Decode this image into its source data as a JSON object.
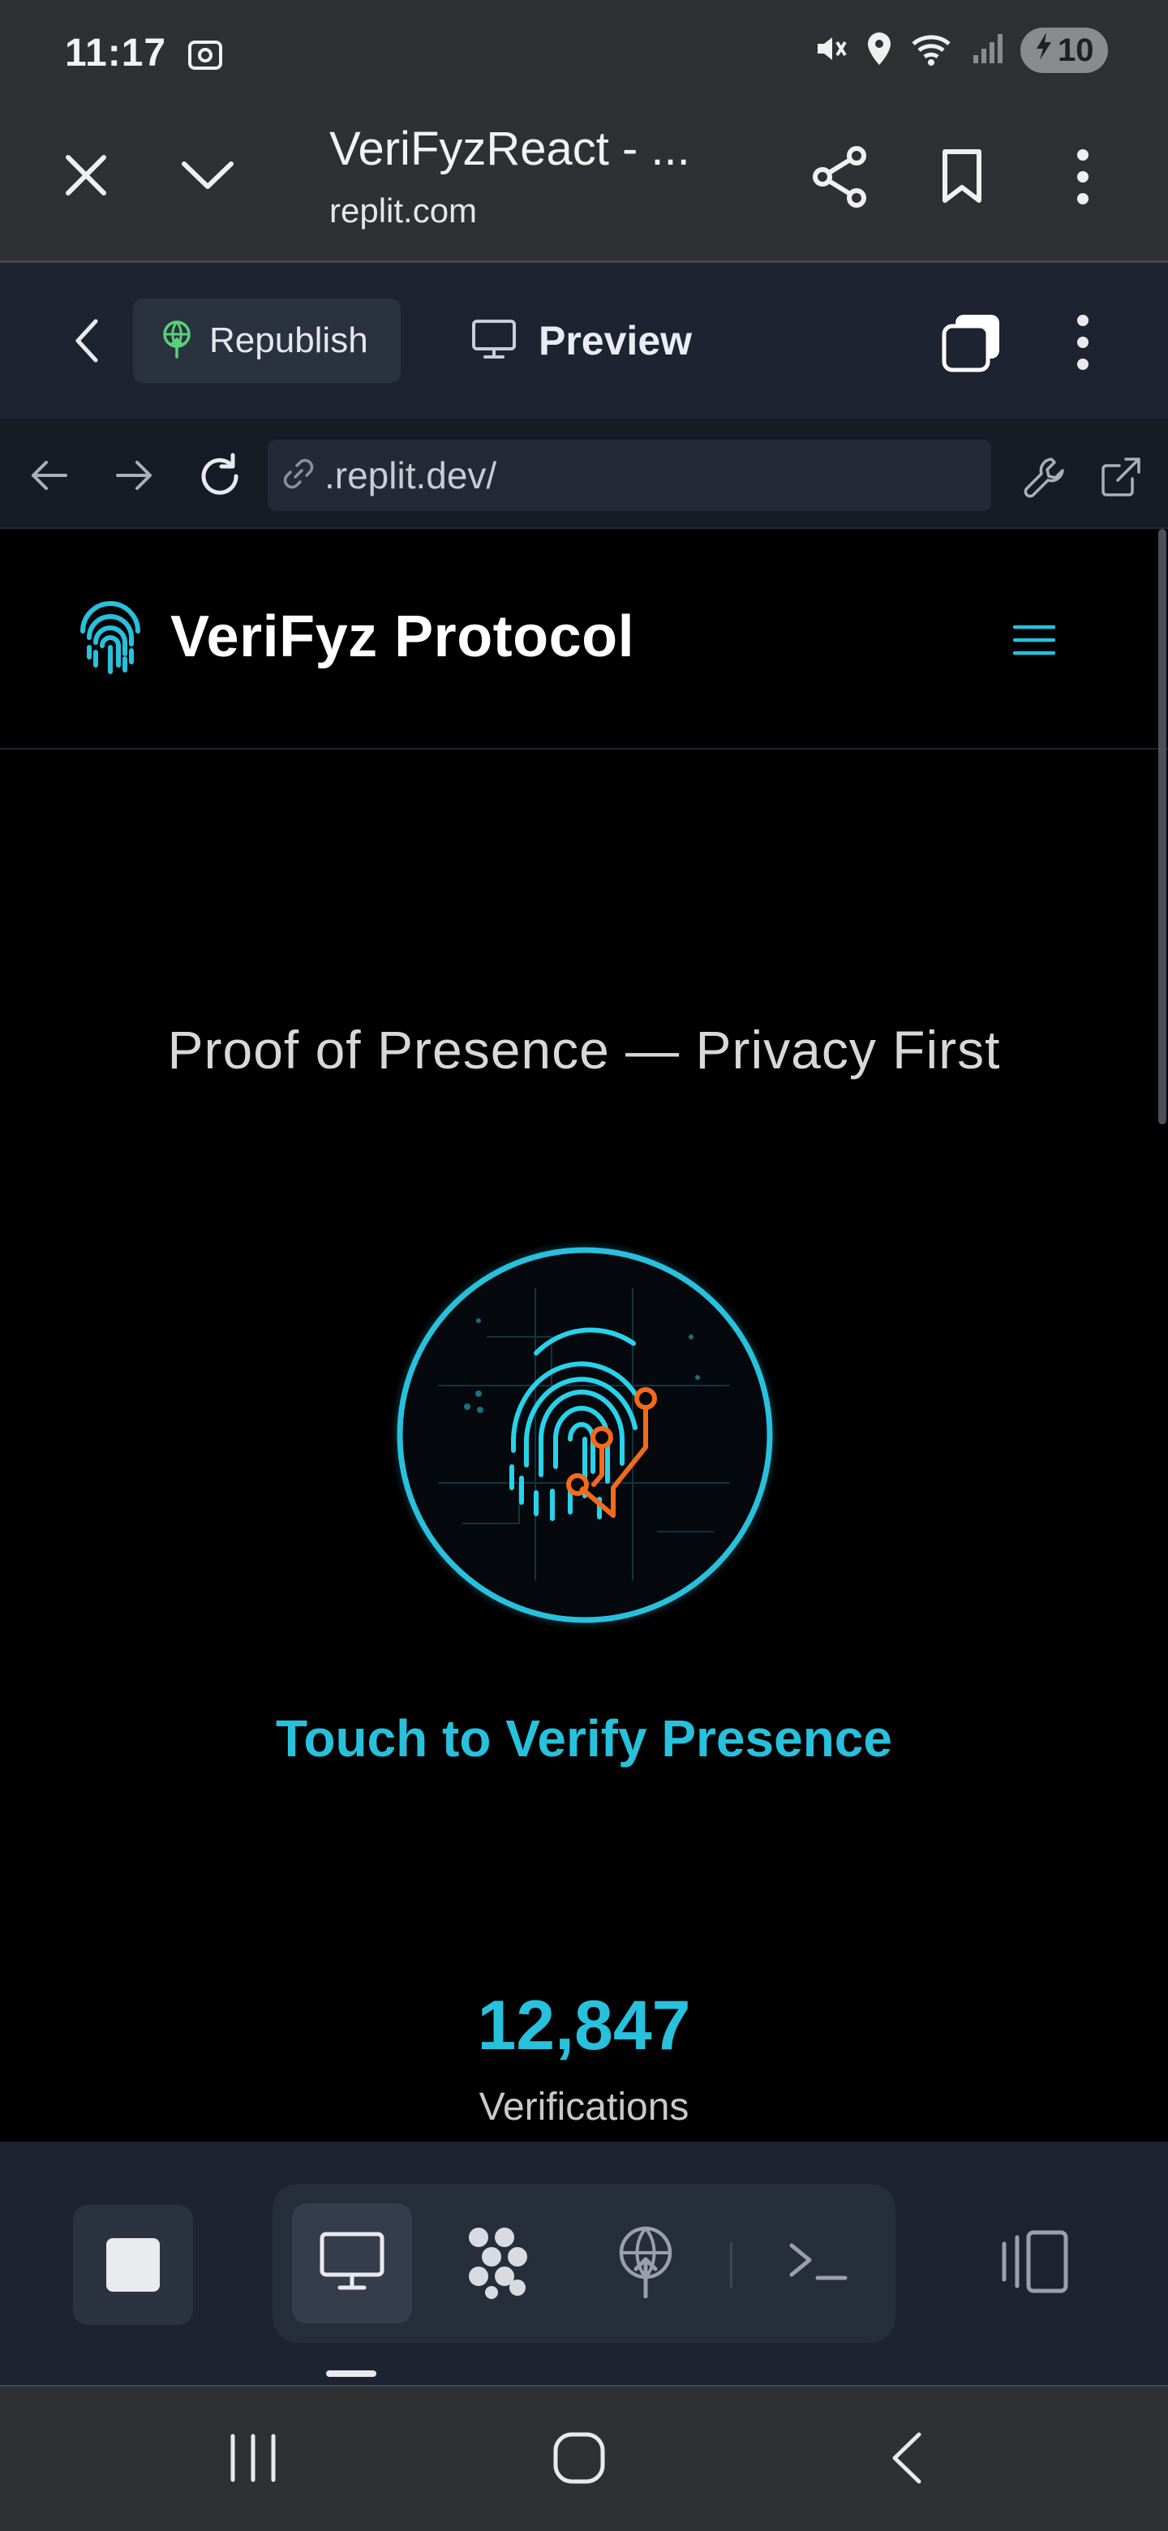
{
  "status_bar": {
    "time": "11:17",
    "battery_level": "10",
    "icons": [
      "screenshot-icon",
      "mute-icon",
      "location-icon",
      "wifi-icon",
      "signal-icon",
      "battery-charging-icon"
    ]
  },
  "browser": {
    "page_title": "VeriFyzReact - ...",
    "host": "replit.com",
    "icons": [
      "close-icon",
      "chevron-down-icon",
      "share-icon",
      "bookmark-icon",
      "more-vert-icon"
    ]
  },
  "replit_header": {
    "republish_label": "Republish",
    "preview_label": "Preview",
    "icons": [
      "back-chevron-icon",
      "republish-icon",
      "monitor-icon",
      "tabs-icon",
      "more-vert-icon"
    ]
  },
  "url_bar": {
    "url": ".replit.dev/",
    "icons": [
      "arrow-back-icon",
      "arrow-forward-icon",
      "reload-icon",
      "link-icon",
      "wrench-icon",
      "open-external-icon"
    ]
  },
  "app": {
    "name": "VeriFyz Protocol",
    "tagline": "Proof of Presence — Privacy First",
    "verify_label": "Touch to Verify Presence",
    "stats": {
      "value": "12,847",
      "label": "Verifications"
    },
    "colors": {
      "accent": "#27c1dd",
      "circuit": "#f26a1b",
      "background": "#000000"
    }
  },
  "dock": {
    "icons": [
      "stop-icon",
      "preview-monitor-icon",
      "agent-icon",
      "deploy-icon",
      "terminal-icon",
      "layout-panel-icon"
    ],
    "active_tab": "preview-monitor-icon"
  },
  "nav_bar": {
    "icons": [
      "recents-icon",
      "home-icon",
      "back-icon"
    ]
  }
}
